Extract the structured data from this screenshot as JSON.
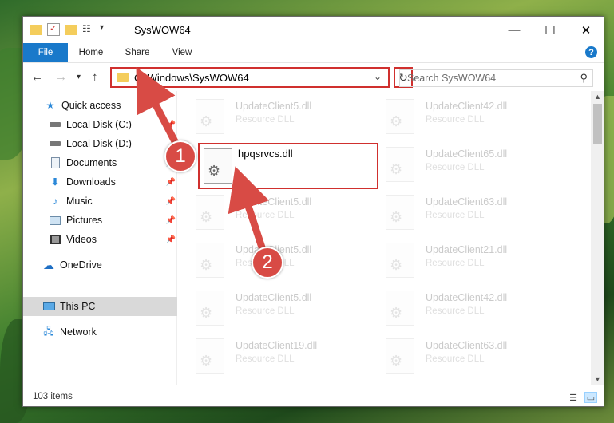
{
  "window": {
    "title": "SysWOW64",
    "controls": {
      "minimize": "—",
      "maximize": "☐",
      "close": "✕"
    }
  },
  "ribbon": {
    "tabs": [
      {
        "label": "File"
      },
      {
        "label": "Home"
      },
      {
        "label": "Share"
      },
      {
        "label": "View"
      }
    ],
    "help_label": "?"
  },
  "navbar": {
    "address": "C:\\Windows\\SysWOW64",
    "search_placeholder": "Search SysWOW64"
  },
  "sidebar": {
    "items": [
      {
        "label": "Quick access",
        "icon": "star-icon"
      },
      {
        "label": "Local Disk (C:)",
        "icon": "drive-icon"
      },
      {
        "label": "Local Disk (D:)",
        "icon": "drive-icon"
      },
      {
        "label": "Documents",
        "icon": "documents-icon"
      },
      {
        "label": "Downloads",
        "icon": "download-icon"
      },
      {
        "label": "Music",
        "icon": "music-icon"
      },
      {
        "label": "Pictures",
        "icon": "pictures-icon"
      },
      {
        "label": "Videos",
        "icon": "videos-icon"
      },
      {
        "label": "OneDrive",
        "icon": "cloud-icon"
      },
      {
        "label": "This PC",
        "icon": "computer-icon"
      },
      {
        "label": "Network",
        "icon": "network-icon"
      }
    ]
  },
  "files": {
    "left_column": [
      {
        "name": "UpdateClient5.dll",
        "type": "Resource DLL"
      },
      {
        "name": "UpdateClient5.dll",
        "type": "Resource DLL"
      },
      {
        "name": "UpdateClient5.dll",
        "type": "Resource DLL"
      },
      {
        "name": "UpdateClient5.dll",
        "type": "Resource DLL"
      },
      {
        "name": "UpdateClient19.dll",
        "type": "Resource DLL"
      }
    ],
    "right_column": [
      {
        "name": "UpdateClient42.dll",
        "type": "Resource DLL"
      },
      {
        "name": "UpdateClient65.dll",
        "type": "Resource DLL"
      },
      {
        "name": "UpdateClient63.dll",
        "type": "Resource DLL"
      },
      {
        "name": "UpdateClient21.dll",
        "type": "Resource DLL"
      },
      {
        "name": "UpdateClient42.dll",
        "type": "Resource DLL"
      },
      {
        "name": "UpdateClient63.dll",
        "type": "Resource DLL"
      }
    ],
    "highlighted": {
      "name": "hpqsrvcs.dll"
    }
  },
  "status": {
    "item_count": "103 items"
  },
  "annotations": {
    "step1": "1",
    "step2": "2",
    "color": "#d0302e"
  }
}
